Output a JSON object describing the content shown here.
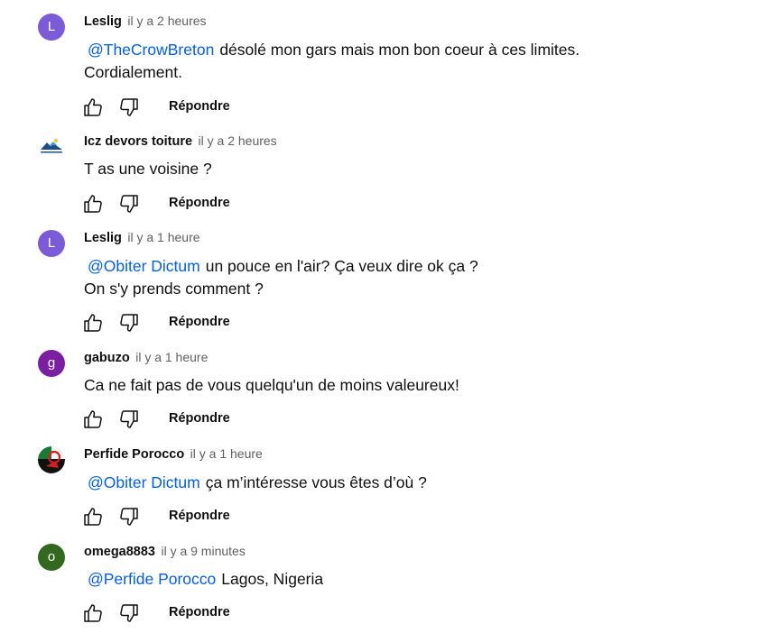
{
  "reply_label": "Répondre",
  "comments": [
    {
      "avatar_letter": "L",
      "avatar_color": "#7c5bd6",
      "author": "Leslig",
      "time": "il y a 2 heures",
      "mention": "@TheCrowBreton",
      "line1": "désolé mon gars mais mon bon coeur à ces limites.",
      "line2": "Cordialement."
    },
    {
      "avatar_letter": "",
      "avatar_color": "#ffffff",
      "author": "Icz devors toiture",
      "time": "il y a 2 heures",
      "mention": "",
      "line1": "T as une voisine ?",
      "line2": ""
    },
    {
      "avatar_letter": "L",
      "avatar_color": "#7c5bd6",
      "author": "Leslig",
      "time": "il y a 1 heure",
      "mention": "@Obiter Dictum",
      "line1": "un pouce en l'air? Ça veux dire ok ça ?",
      "line2": "On s'y prends comment ?"
    },
    {
      "avatar_letter": "g",
      "avatar_color": "#7b1fa2",
      "author": "gabuzo",
      "time": "il y a 1 heure",
      "mention": "",
      "line1": "Ca ne fait pas de vous quelqu'un de moins valeureux!",
      "line2": ""
    },
    {
      "avatar_letter": "",
      "avatar_color": "#ffffff",
      "author": "Perfide Porocco",
      "time": "il y a 1 heure",
      "mention": "@Obiter Dictum",
      "line1": "ça m’intéresse vous êtes d’où ?",
      "line2": ""
    },
    {
      "avatar_letter": "o",
      "avatar_color": "#33691e",
      "author": "omega8883",
      "time": "il y a 9 minutes",
      "mention": "@Perfide Porocco",
      "line1": "Lagos, Nigeria",
      "line2": ""
    }
  ]
}
